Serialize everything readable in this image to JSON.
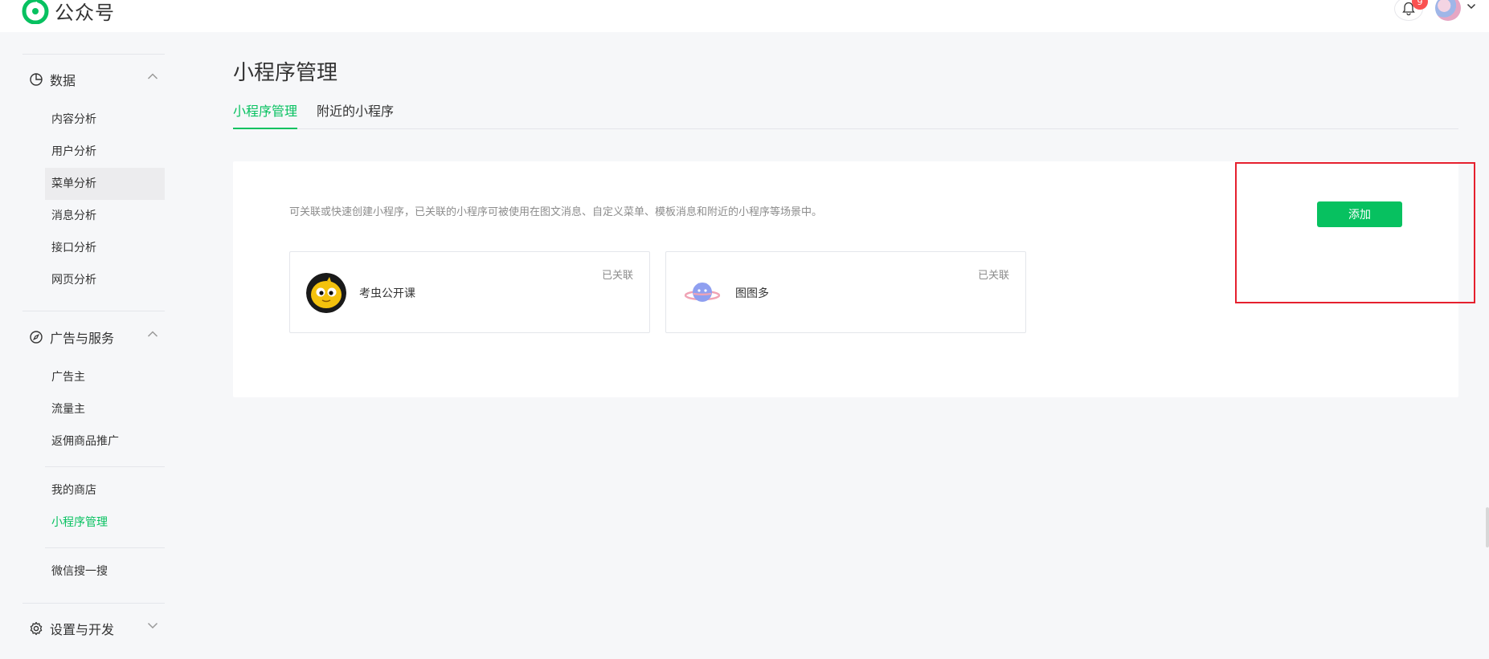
{
  "header": {
    "app_name": "公众号",
    "notification_count": "9",
    "brand_color": "#07c160"
  },
  "sidebar": {
    "groups": [
      {
        "label": "数据",
        "icon": "chart-pie-icon",
        "expanded": true,
        "items": [
          "内容分析",
          "用户分析",
          "菜单分析",
          "消息分析",
          "接口分析",
          "网页分析"
        ]
      },
      {
        "label": "广告与服务",
        "icon": "compass-icon",
        "expanded": true,
        "items": [
          "广告主",
          "流量主",
          "返佣商品推广",
          "我的商店",
          "小程序管理",
          "微信搜一搜"
        ]
      },
      {
        "label": "设置与开发",
        "icon": "gear-icon",
        "expanded": false,
        "items": []
      }
    ],
    "hovered_item": "菜单分析",
    "active_item": "小程序管理"
  },
  "main": {
    "title": "小程序管理",
    "tabs": [
      {
        "label": "小程序管理",
        "active": true
      },
      {
        "label": "附近的小程序",
        "active": false
      }
    ],
    "description": "可关联或快速创建小程序，已关联的小程序可被使用在图文消息、自定义菜单、模板消息和附近的小程序等场景中。",
    "add_button": "添加",
    "cards": [
      {
        "name": "考虫公开课",
        "status": "已关联",
        "icon": "kaochong-logo-icon"
      },
      {
        "name": "图图多",
        "status": "已关联",
        "icon": "tutuduo-planet-logo-icon"
      }
    ]
  }
}
